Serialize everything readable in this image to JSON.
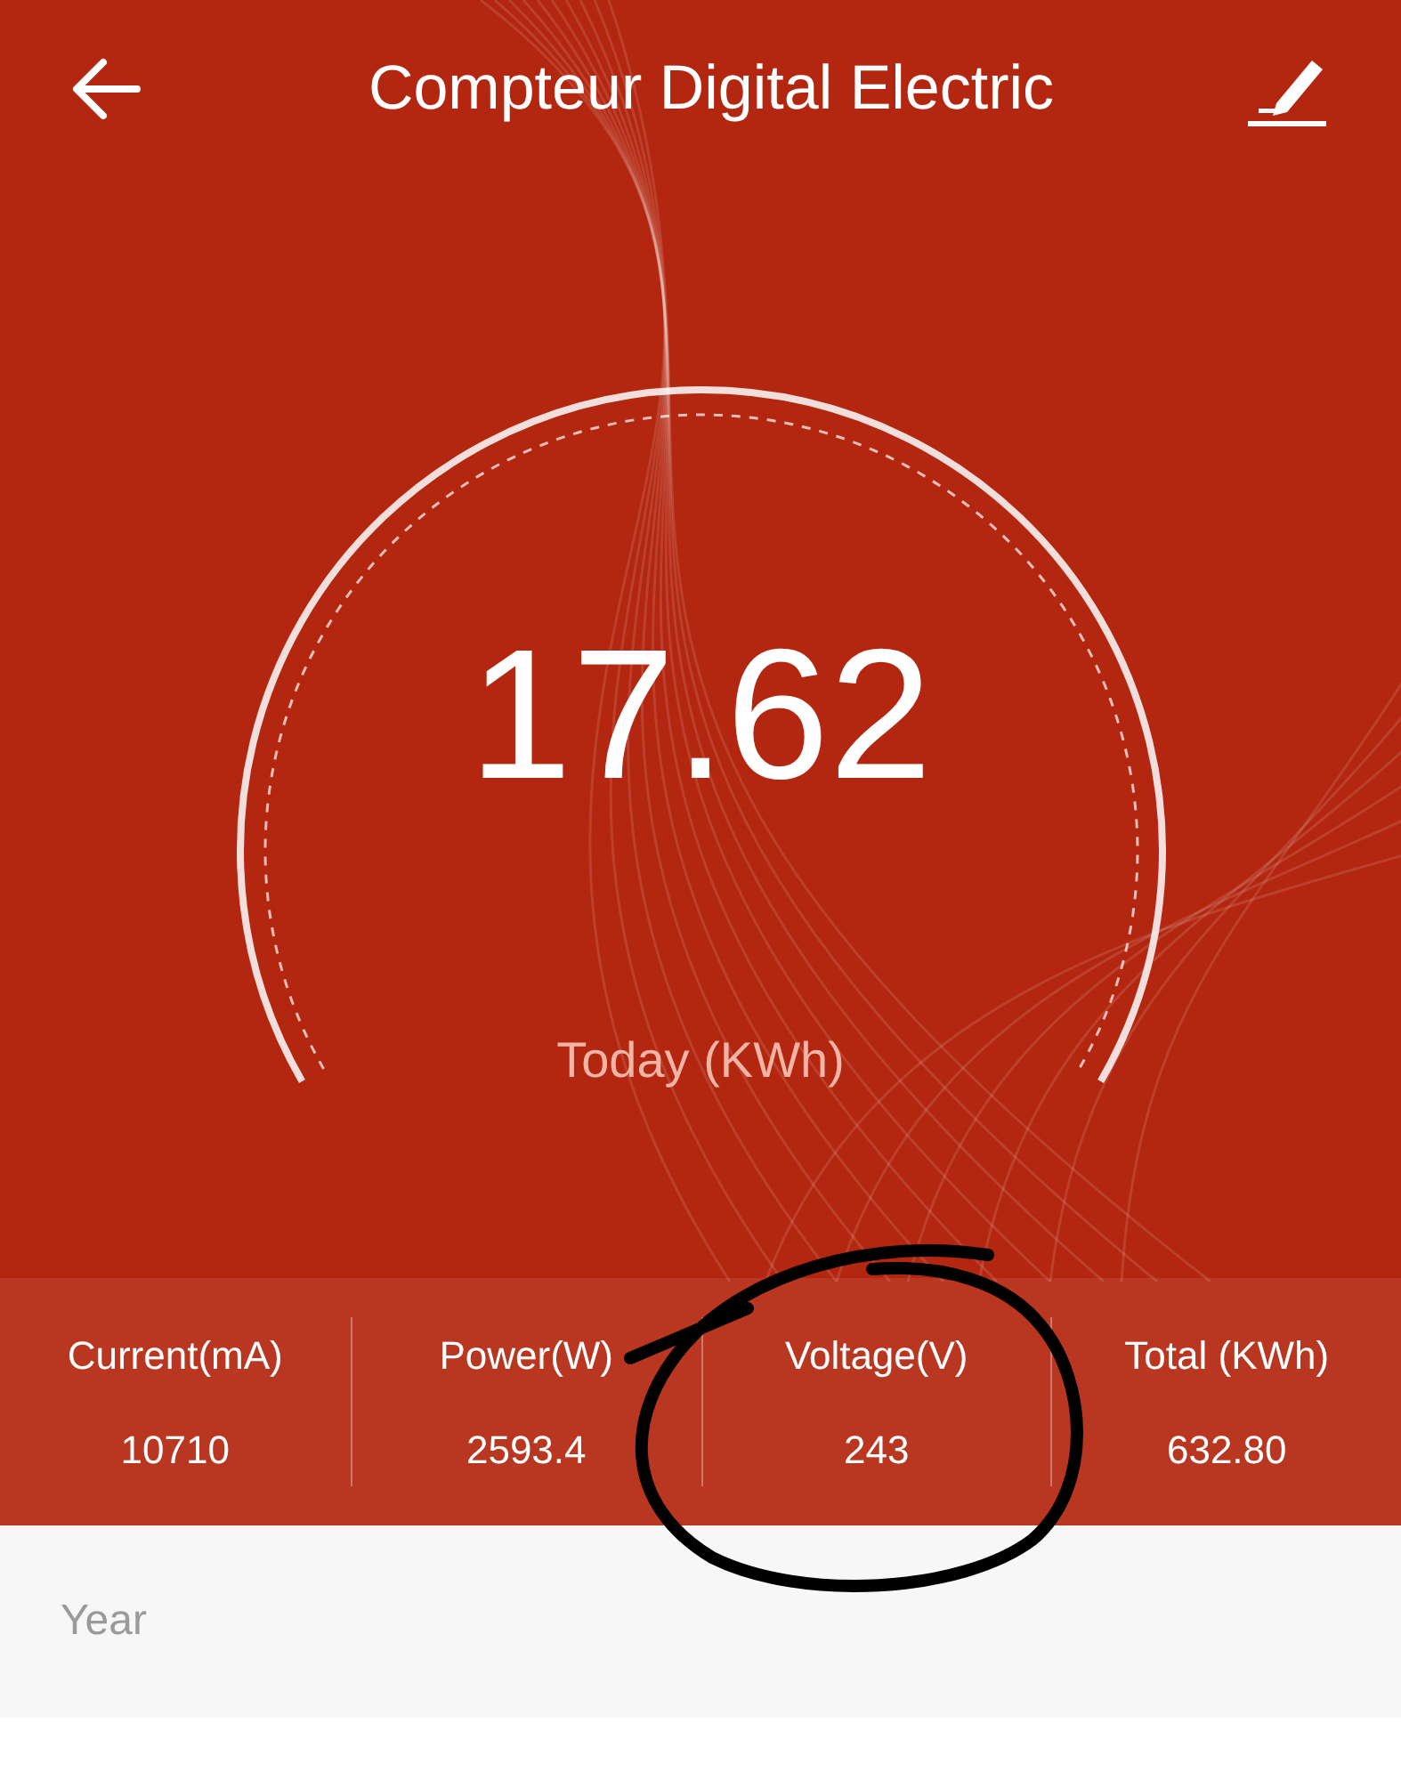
{
  "header": {
    "title": "Compteur Digital Electric"
  },
  "gauge": {
    "value": "17.62",
    "label": "Today (KWh)"
  },
  "stats": [
    {
      "label": "Current(mA)",
      "value": "10710"
    },
    {
      "label": "Power(W)",
      "value": "2593.4"
    },
    {
      "label": "Voltage(V)",
      "value": "243"
    },
    {
      "label": "Total (KWh)",
      "value": "632.80"
    }
  ],
  "period": {
    "label": "Year"
  }
}
